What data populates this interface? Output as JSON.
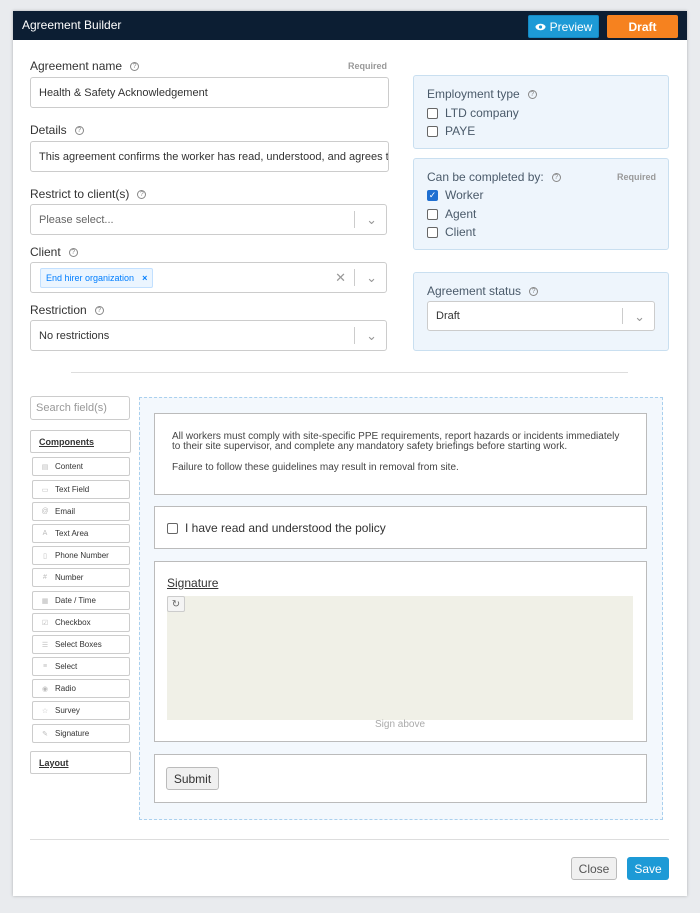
{
  "header": {
    "title": "Agreement Builder",
    "preview_label": "Preview",
    "draft_label": "Draft"
  },
  "form": {
    "agreement_name": {
      "label": "Agreement name",
      "required": "Required",
      "value": "Health & Safety Acknowledgement"
    },
    "details": {
      "label": "Details",
      "value": "This agreement confirms the worker has read, understood, and agrees t"
    },
    "restrict_to_clients": {
      "label": "Restrict to client(s)",
      "placeholder": "Please select..."
    },
    "client": {
      "label": "Client",
      "tag": "End hirer organization",
      "tag_remove": "×"
    },
    "restriction": {
      "label": "Restriction",
      "value": "No restrictions"
    }
  },
  "employment_type": {
    "title": "Employment type",
    "options": [
      {
        "label": "LTD company",
        "checked": false
      },
      {
        "label": "PAYE",
        "checked": false
      }
    ]
  },
  "completed_by": {
    "title": "Can be completed by:",
    "required": "Required",
    "options": [
      {
        "label": "Worker",
        "checked": true
      },
      {
        "label": "Agent",
        "checked": false
      },
      {
        "label": "Client",
        "checked": false
      }
    ]
  },
  "agreement_status": {
    "title": "Agreement status",
    "value": "Draft"
  },
  "builder": {
    "search_placeholder": "Search field(s)",
    "components_label": "Components",
    "layout_label": "Layout",
    "components": [
      {
        "label": "Content",
        "icon": "content-icon"
      },
      {
        "label": "Text Field",
        "icon": "text-field-icon"
      },
      {
        "label": "Email",
        "icon": "at-icon"
      },
      {
        "label": "Text Area",
        "icon": "text-area-icon"
      },
      {
        "label": "Phone Number",
        "icon": "phone-icon"
      },
      {
        "label": "Number",
        "icon": "hash-icon"
      },
      {
        "label": "Date / Time",
        "icon": "calendar-icon"
      },
      {
        "label": "Checkbox",
        "icon": "checkbox-icon"
      },
      {
        "label": "Select Boxes",
        "icon": "list-icon"
      },
      {
        "label": "Select",
        "icon": "select-icon"
      },
      {
        "label": "Radio",
        "icon": "radio-icon"
      },
      {
        "label": "Survey",
        "icon": "survey-icon"
      },
      {
        "label": "Signature",
        "icon": "pen-icon"
      }
    ]
  },
  "preview": {
    "content_line1": "All workers must comply with site-specific PPE requirements, report hazards or incidents immediately",
    "content_line2": "to their site supervisor, and complete any mandatory safety briefings before starting work.",
    "content_line3": "Failure to follow these guidelines may result in removal from site.",
    "checkbox_label": "I have read and understood the policy",
    "signature_label": "Signature",
    "signature_hint": "Sign above",
    "submit_label": "Submit"
  },
  "footer": {
    "close_label": "Close",
    "save_label": "Save"
  }
}
